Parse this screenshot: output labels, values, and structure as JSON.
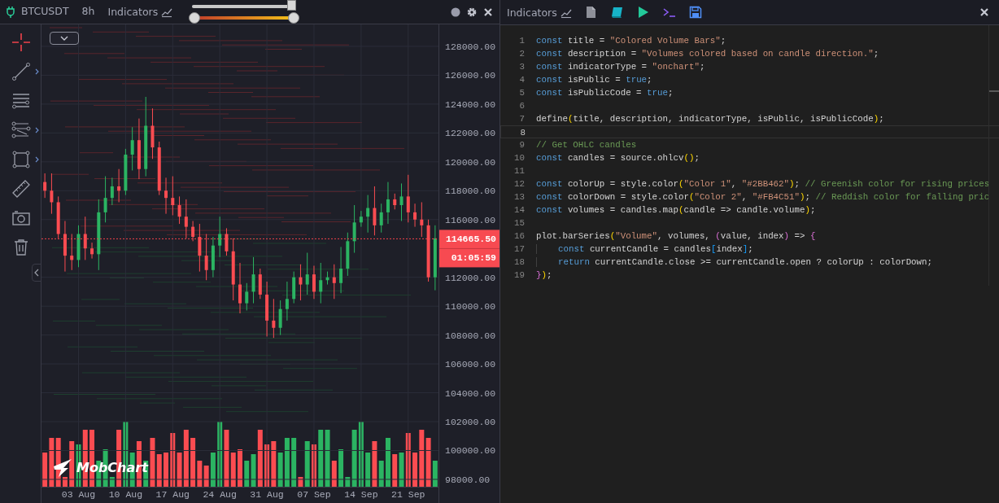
{
  "chart_panel": {
    "symbol": "BTCUSDT",
    "timeframe": "8h",
    "indicators_label": "Indicators",
    "sliders": [
      {
        "kind": "single",
        "level": 1
      },
      {
        "kind": "range",
        "level": 1
      }
    ],
    "tools": [
      {
        "kind": "crosshair",
        "selected": true,
        "submenu": false
      },
      {
        "kind": "trendline",
        "selected": false,
        "submenu": true
      },
      {
        "kind": "hlines",
        "selected": false,
        "submenu": false
      },
      {
        "kind": "channel",
        "selected": false,
        "submenu": true
      },
      {
        "kind": "rectangle",
        "selected": false,
        "submenu": true
      },
      {
        "kind": "ruler",
        "selected": false,
        "submenu": false
      },
      {
        "kind": "camera",
        "selected": false,
        "submenu": false
      },
      {
        "kind": "trash",
        "selected": false,
        "submenu": false
      }
    ]
  },
  "chart": {
    "last_price": "114665.50",
    "countdown": "01:05:59",
    "brand": "MobChart",
    "chart_data": {
      "type": "candlestick",
      "grid": true,
      "ylim": [
        97490,
        129520
      ],
      "ref_lines": [
        {
          "axis": "y",
          "value": 114665.5
        }
      ],
      "categories": [
        null,
        null,
        null,
        null,
        null,
        "03 Aug",
        null,
        null,
        null,
        null,
        null,
        null,
        "10 Aug",
        null,
        null,
        null,
        null,
        null,
        null,
        "17 Aug",
        null,
        null,
        null,
        null,
        null,
        null,
        "24 Aug",
        null,
        null,
        null,
        null,
        null,
        null,
        "31 Aug",
        null,
        null,
        null,
        null,
        null,
        null,
        "07 Sep",
        null,
        null,
        null,
        null,
        null,
        null,
        "14 Sep",
        null,
        null,
        null,
        null,
        null,
        null,
        "21 Sep",
        null,
        null,
        null,
        null
      ],
      "ohlc": [
        [
          118600,
          119200,
          117500,
          118000
        ],
        [
          118000,
          119200,
          116400,
          117200
        ],
        [
          117200,
          117600,
          114700,
          115000
        ],
        [
          115000,
          115900,
          112400,
          113500
        ],
        [
          113500,
          115000,
          112500,
          113200
        ],
        [
          113200,
          115600,
          112700,
          115000
        ],
        [
          115000,
          116200,
          113200,
          114000
        ],
        [
          114000,
          114400,
          113300,
          113600
        ],
        [
          113600,
          117400,
          112500,
          116500
        ],
        [
          116500,
          119000,
          115800,
          117500
        ],
        [
          117500,
          118900,
          117000,
          118300
        ],
        [
          118300,
          119500,
          117200,
          118000
        ],
        [
          118000,
          120900,
          117700,
          120500
        ],
        [
          120500,
          122400,
          119400,
          121500
        ],
        [
          121500,
          123000,
          118800,
          119500
        ],
        [
          119500,
          124500,
          119000,
          122500
        ],
        [
          122500,
          123700,
          120200,
          121000
        ],
        [
          121000,
          121400,
          117700,
          118000
        ],
        [
          118000,
          118900,
          116400,
          117500
        ],
        [
          117500,
          119000,
          116300,
          117000
        ],
        [
          117000,
          117600,
          115700,
          116200
        ],
        [
          116200,
          117400,
          114700,
          115500
        ],
        [
          115500,
          115900,
          114500,
          114800
        ],
        [
          114800,
          115700,
          112400,
          113500
        ],
        [
          113500,
          115000,
          111800,
          112500
        ],
        [
          112500,
          114800,
          112000,
          114200
        ],
        [
          114200,
          116200,
          113400,
          115000
        ],
        [
          115000,
          115400,
          113500,
          113800
        ],
        [
          113800,
          114700,
          110400,
          111500
        ],
        [
          111500,
          113000,
          109500,
          110200
        ],
        [
          110200,
          111600,
          109700,
          111000
        ],
        [
          111000,
          113400,
          110200,
          112200
        ],
        [
          112200,
          112600,
          110500,
          110800
        ],
        [
          110800,
          111700,
          107900,
          109000
        ],
        [
          109000,
          110500,
          107800,
          108500
        ],
        [
          108500,
          110400,
          108000,
          109800
        ],
        [
          109800,
          111700,
          109000,
          110500
        ],
        [
          110500,
          112400,
          110200,
          112000
        ],
        [
          112000,
          112900,
          110400,
          111500
        ],
        [
          111500,
          113700,
          110800,
          112200
        ],
        [
          112200,
          112800,
          110500,
          111000
        ],
        [
          111000,
          113000,
          110200,
          111800
        ],
        [
          111800,
          112400,
          111500,
          112000
        ],
        [
          112000,
          112900,
          110500,
          111600
        ],
        [
          111600,
          114100,
          110900,
          112600
        ],
        [
          112600,
          115100,
          112100,
          114500
        ],
        [
          114500,
          117000,
          113700,
          115800
        ],
        [
          115800,
          116600,
          115500,
          116200
        ],
        [
          116200,
          117700,
          115100,
          116800
        ],
        [
          116800,
          118300,
          114900,
          115600
        ],
        [
          115600,
          117100,
          115100,
          116500
        ],
        [
          116500,
          118600,
          115700,
          117400
        ],
        [
          117400,
          117800,
          116700,
          117000
        ],
        [
          117000,
          118500,
          115900,
          117600
        ],
        [
          117600,
          119100,
          115800,
          116500
        ],
        [
          116500,
          117100,
          115500,
          116000
        ],
        [
          116000,
          117200,
          114800,
          115600
        ],
        [
          115600,
          116000,
          111700,
          112000
        ],
        [
          112000,
          115600,
          111100,
          114700
        ]
      ],
      "yticks": [
        {
          "value": 98000,
          "label": "98000.00"
        },
        {
          "value": 100000,
          "label": "100000.00"
        },
        {
          "value": 102000,
          "label": "102000.00"
        },
        {
          "value": 104000,
          "label": "104000.00"
        },
        {
          "value": 106000,
          "label": "106000.00"
        },
        {
          "value": 108000,
          "label": "108000.00"
        },
        {
          "value": 110000,
          "label": "110000.00"
        },
        {
          "value": 112000,
          "label": "112000.00"
        },
        {
          "value": 116000,
          "label": "116000.00"
        },
        {
          "value": 118000,
          "label": "118000.00"
        },
        {
          "value": 120000,
          "label": "120000.00"
        },
        {
          "value": 122000,
          "label": "122000.00"
        },
        {
          "value": 124000,
          "label": "124000.00"
        },
        {
          "value": 126000,
          "label": "126000.00"
        },
        {
          "value": 128000,
          "label": "128000.00"
        }
      ]
    }
  },
  "editor": {
    "title": "Indicators",
    "lines": [
      {
        "number": "1",
        "current": false,
        "indent": false,
        "tokens": [
          {
            "kind": "kw",
            "text": "const"
          },
          {
            "kind": "plain",
            "text": " title = "
          },
          {
            "kind": "str",
            "text": "\"Colored Volume Bars\""
          },
          {
            "kind": "plain",
            "text": ";"
          }
        ]
      },
      {
        "number": "2",
        "current": false,
        "indent": false,
        "tokens": [
          {
            "kind": "kw",
            "text": "const"
          },
          {
            "kind": "plain",
            "text": " description = "
          },
          {
            "kind": "str",
            "text": "\"Volumes colored based on candle direction.\""
          },
          {
            "kind": "plain",
            "text": ";"
          }
        ]
      },
      {
        "number": "3",
        "current": false,
        "indent": false,
        "tokens": [
          {
            "kind": "kw",
            "text": "const"
          },
          {
            "kind": "plain",
            "text": " indicatorType = "
          },
          {
            "kind": "str",
            "text": "\"onchart\""
          },
          {
            "kind": "plain",
            "text": ";"
          }
        ]
      },
      {
        "number": "4",
        "current": false,
        "indent": false,
        "tokens": [
          {
            "kind": "kw",
            "text": "const"
          },
          {
            "kind": "plain",
            "text": " isPublic = "
          },
          {
            "kind": "kw",
            "text": "true"
          },
          {
            "kind": "plain",
            "text": ";"
          }
        ]
      },
      {
        "number": "5",
        "current": false,
        "indent": false,
        "tokens": [
          {
            "kind": "kw",
            "text": "const"
          },
          {
            "kind": "plain",
            "text": " isPublicCode = "
          },
          {
            "kind": "kw",
            "text": "true"
          },
          {
            "kind": "plain",
            "text": ";"
          }
        ]
      },
      {
        "number": "6",
        "current": false
      },
      {
        "number": "7",
        "current": false,
        "indent": false,
        "tokens": [
          {
            "kind": "plain",
            "text": "define"
          },
          {
            "kind": "b1",
            "text": "("
          },
          {
            "kind": "plain",
            "text": "title, description, indicatorType, isPublic, isPublicCode"
          },
          {
            "kind": "b1",
            "text": ")"
          },
          {
            "kind": "plain",
            "text": ";"
          }
        ]
      },
      {
        "number": "8",
        "current": true
      },
      {
        "number": "9",
        "current": false,
        "indent": false,
        "tokens": [
          {
            "kind": "cmt",
            "text": "// Get OHLC candles"
          }
        ]
      },
      {
        "number": "10",
        "current": false,
        "indent": false,
        "tokens": [
          {
            "kind": "kw",
            "text": "const"
          },
          {
            "kind": "plain",
            "text": " candles = source.ohlcv"
          },
          {
            "kind": "b1",
            "text": "()"
          },
          {
            "kind": "plain",
            "text": ";"
          }
        ]
      },
      {
        "number": "11",
        "current": false
      },
      {
        "number": "12",
        "current": false,
        "indent": false,
        "tokens": [
          {
            "kind": "kw",
            "text": "const"
          },
          {
            "kind": "plain",
            "text": " colorUp = style.color"
          },
          {
            "kind": "b1",
            "text": "("
          },
          {
            "kind": "str",
            "text": "\"Color 1\""
          },
          {
            "kind": "plain",
            "text": ", "
          },
          {
            "kind": "str",
            "text": "\"#2BB462\""
          },
          {
            "kind": "b1",
            "text": ")"
          },
          {
            "kind": "plain",
            "text": "; "
          },
          {
            "kind": "cmt",
            "text": "// Greenish color for rising prices"
          }
        ]
      },
      {
        "number": "13",
        "current": false,
        "indent": false,
        "tokens": [
          {
            "kind": "kw",
            "text": "const"
          },
          {
            "kind": "plain",
            "text": " colorDown = style.color"
          },
          {
            "kind": "b1",
            "text": "("
          },
          {
            "kind": "str",
            "text": "\"Color 2\""
          },
          {
            "kind": "plain",
            "text": ", "
          },
          {
            "kind": "str",
            "text": "\"#FB4C51\""
          },
          {
            "kind": "b1",
            "text": ")"
          },
          {
            "kind": "plain",
            "text": "; "
          },
          {
            "kind": "cmt",
            "text": "// Reddish color for falling pric"
          }
        ]
      },
      {
        "number": "14",
        "current": false,
        "indent": false,
        "tokens": [
          {
            "kind": "kw",
            "text": "const"
          },
          {
            "kind": "plain",
            "text": " volumes = candles.map"
          },
          {
            "kind": "b1",
            "text": "("
          },
          {
            "kind": "plain",
            "text": "candle => candle.volume"
          },
          {
            "kind": "b1",
            "text": ")"
          },
          {
            "kind": "plain",
            "text": ";"
          }
        ]
      },
      {
        "number": "15",
        "current": false
      },
      {
        "number": "16",
        "current": false,
        "indent": false,
        "tokens": [
          {
            "kind": "plain",
            "text": "plot.barSeries"
          },
          {
            "kind": "b1",
            "text": "("
          },
          {
            "kind": "str",
            "text": "\"Volume\""
          },
          {
            "kind": "plain",
            "text": ", volumes, "
          },
          {
            "kind": "b2",
            "text": "("
          },
          {
            "kind": "plain",
            "text": "value, index"
          },
          {
            "kind": "b2",
            "text": ")"
          },
          {
            "kind": "plain",
            "text": " => "
          },
          {
            "kind": "b2",
            "text": "{"
          }
        ]
      },
      {
        "number": "17",
        "current": false,
        "indent": true,
        "tokens": [
          {
            "kind": "kw",
            "text": "const"
          },
          {
            "kind": "plain",
            "text": " currentCandle = candles"
          },
          {
            "kind": "b3",
            "text": "["
          },
          {
            "kind": "plain",
            "text": "index"
          },
          {
            "kind": "b3",
            "text": "]"
          },
          {
            "kind": "plain",
            "text": ";"
          }
        ]
      },
      {
        "number": "18",
        "current": false,
        "indent": true,
        "tokens": [
          {
            "kind": "kw",
            "text": "return"
          },
          {
            "kind": "plain",
            "text": " currentCandle.close >= currentCandle.open ? colorUp : colorDown;"
          }
        ]
      },
      {
        "number": "19",
        "current": false,
        "indent": false,
        "tokens": [
          {
            "kind": "b2",
            "text": "}"
          },
          {
            "kind": "b1",
            "text": ")"
          },
          {
            "kind": "plain",
            "text": ";"
          }
        ]
      }
    ]
  }
}
